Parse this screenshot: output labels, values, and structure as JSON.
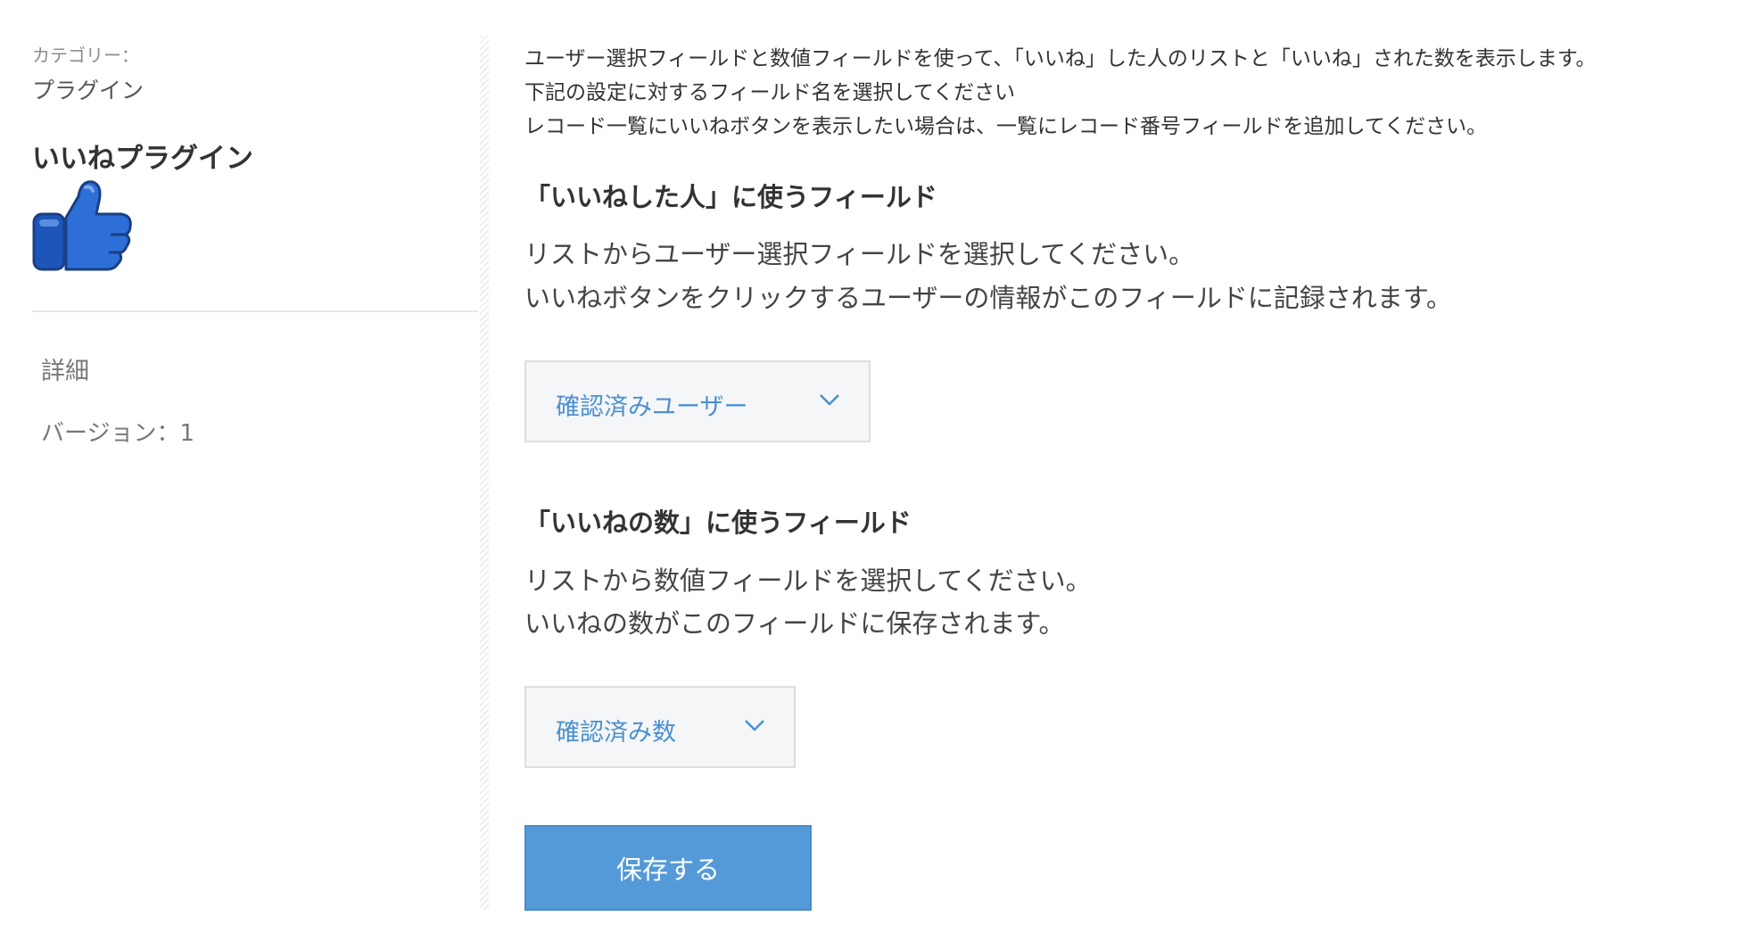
{
  "sidebar": {
    "category_label": "カテゴリー：",
    "category_value": "プラグイン",
    "plugin_name": "いいねプラグイン",
    "plugin_icon": "thumbs-up-icon",
    "detail_label": "詳細",
    "version_label": "バージョン：1"
  },
  "main": {
    "intro": [
      "ユーザー選択フィールドと数値フィールドを使って、「いいね」した人のリストと「いいね」された数を表示します。",
      "下記の設定に対するフィールド名を選択してください",
      "レコード一覧にいいねボタンを表示したい場合は、一覧にレコード番号フィールドを追加してください。"
    ],
    "liked_users_section": {
      "heading": "「いいねした人」に使うフィールド",
      "desc_line1": "リストからユーザー選択フィールドを選択してください。",
      "desc_line2": "いいねボタンをクリックするユーザーの情報がこのフィールドに記録されます。",
      "selected_value": "確認済みユーザー"
    },
    "like_count_section": {
      "heading": "「いいねの数」に使うフィールド",
      "desc_line1": "リストから数値フィールドを選択してください。",
      "desc_line2": "いいねの数がこのフィールドに保存されます。",
      "selected_value": "確認済み数"
    },
    "save_label": "保存する"
  },
  "colors": {
    "accent": "#549ad9",
    "select_text": "#4a90cf",
    "icon_blue": "#1d56b8"
  }
}
